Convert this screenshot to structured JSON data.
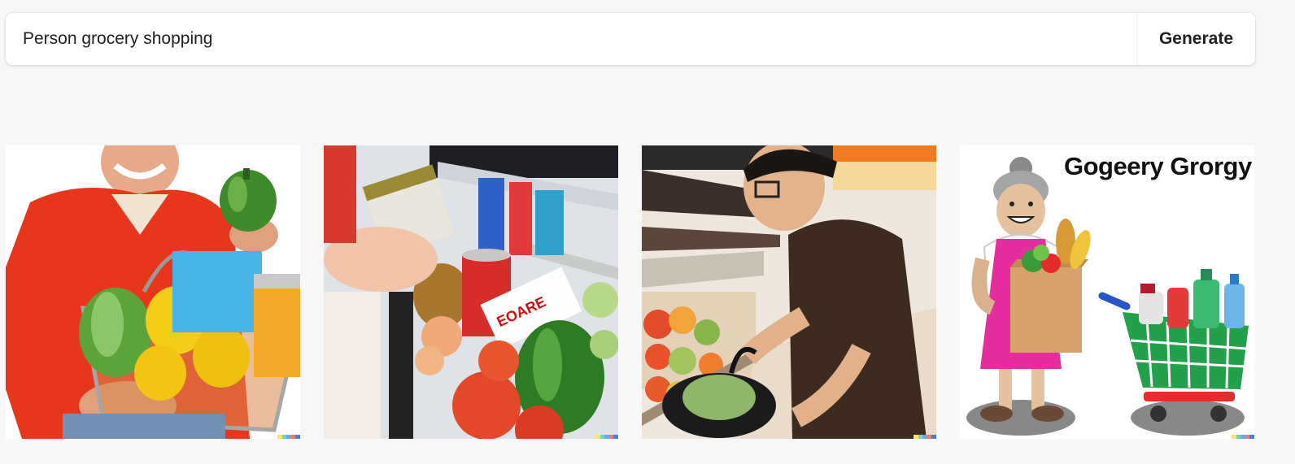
{
  "prompt": {
    "value": "Person grocery shopping",
    "generate_label": "Generate"
  },
  "results": [
    {
      "name": "result-image-1",
      "icon": "man-with-produce-basket"
    },
    {
      "name": "result-image-2",
      "icon": "hand-picking-can-in-aisle"
    },
    {
      "name": "result-image-3",
      "icon": "man-shopping-in-produce-aisle"
    },
    {
      "name": "result-image-4",
      "icon": "cartoon-grandma-with-cart",
      "poster_text": "Gogeery Grorgy"
    }
  ],
  "signature_colors": [
    "#f5e663",
    "#71d3c3",
    "#6fa8f0",
    "#f07b6b",
    "#4a7fe0"
  ]
}
